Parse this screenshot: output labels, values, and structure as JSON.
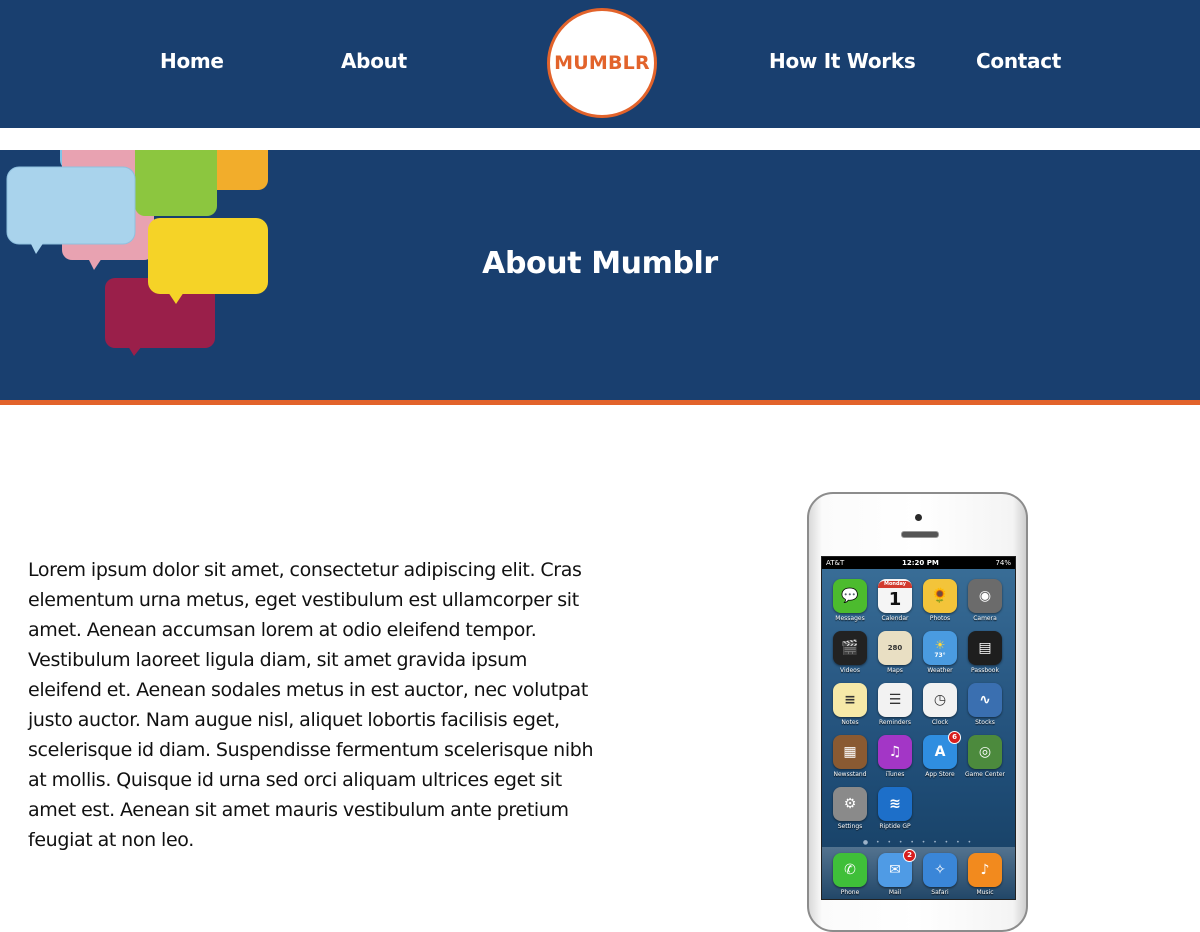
{
  "nav": {
    "links": [
      "Home",
      "About",
      "How It Works",
      "Contact"
    ],
    "logo_text": "MUMBLR"
  },
  "hero": {
    "title": "About Mumblr"
  },
  "about": {
    "text": "Lorem ipsum dolor sit amet, consectetur adipiscing elit. Cras elementum urna metus, eget vestibulum est ullamcorper sit amet. Aenean accumsan lorem at odio eleifend tempor. Vestibulum laoreet ligula diam, sit amet gravida ipsum eleifend et. Aenean sodales metus in est auctor, nec volutpat justo auctor. Nam augue nisl, aliquet lobortis facilisis eget, scelerisque id diam. Suspendisse fermentum scelerisque nibh at mollis. Quisque id urna sed orci aliquam ultrices eget sit amet est. Aenean sit amet mauris vestibulum ante pretium feugiat at non leo."
  },
  "phone": {
    "status": {
      "carrier": "AT&T",
      "time": "12:20 PM",
      "battery": "74%"
    },
    "calendar": {
      "weekday": "Monday",
      "day": "1"
    },
    "weather_temp": "73°",
    "apps": [
      {
        "label": "Messages",
        "color": "#4cbb2e",
        "icon": "messages-icon",
        "glyph": "💬"
      },
      {
        "label": "Calendar",
        "color": "#f5f5f5",
        "icon": "calendar-icon",
        "glyph": ""
      },
      {
        "label": "Photos",
        "color": "#f3c43a",
        "icon": "photos-icon",
        "glyph": "🌻"
      },
      {
        "label": "Camera",
        "color": "#6b6b6b",
        "icon": "camera-icon",
        "glyph": "◉"
      },
      {
        "label": "Videos",
        "color": "#222222",
        "icon": "videos-icon",
        "glyph": "🎬"
      },
      {
        "label": "Maps",
        "color": "#e9dfc3",
        "icon": "maps-icon",
        "glyph": "280"
      },
      {
        "label": "Weather",
        "color": "#4a9be0",
        "icon": "weather-icon",
        "glyph": "☀"
      },
      {
        "label": "Passbook",
        "color": "#1e1e1e",
        "icon": "passbook-icon",
        "glyph": "▤"
      },
      {
        "label": "Notes",
        "color": "#f6e9a8",
        "icon": "notes-icon",
        "glyph": "≡"
      },
      {
        "label": "Reminders",
        "color": "#f2f2f2",
        "icon": "reminders-icon",
        "glyph": "☰"
      },
      {
        "label": "Clock",
        "color": "#f2f2f2",
        "icon": "clock-icon",
        "glyph": "◷"
      },
      {
        "label": "Stocks",
        "color": "#3a6fb0",
        "icon": "stocks-icon",
        "glyph": "∿"
      },
      {
        "label": "Newsstand",
        "color": "#8a5a32",
        "icon": "newsstand-icon",
        "glyph": "▦"
      },
      {
        "label": "iTunes",
        "color": "#a336c6",
        "icon": "itunes-icon",
        "glyph": "♫"
      },
      {
        "label": "App Store",
        "color": "#2f8ee0",
        "icon": "app-store-icon",
        "glyph": "A",
        "badge": "6"
      },
      {
        "label": "Game Center",
        "color": "#4c8a3d",
        "icon": "game-center-icon",
        "glyph": "◎"
      },
      {
        "label": "Settings",
        "color": "#8a8a8a",
        "icon": "settings-icon",
        "glyph": "⚙"
      },
      {
        "label": "Riptide GP",
        "color": "#1d6fc9",
        "icon": "riptide-gp-icon",
        "glyph": "≋"
      }
    ],
    "dock": [
      {
        "label": "Phone",
        "color": "#3fbf39",
        "icon": "phone-icon",
        "glyph": "✆"
      },
      {
        "label": "Mail",
        "color": "#4f9be5",
        "icon": "mail-icon",
        "glyph": "✉",
        "badge": "2"
      },
      {
        "label": "Safari",
        "color": "#3a86d8",
        "icon": "safari-icon",
        "glyph": "✧"
      },
      {
        "label": "Music",
        "color": "#f28a1e",
        "icon": "music-icon",
        "glyph": "♪"
      }
    ]
  },
  "colors": {
    "navy": "#193f6f",
    "accent": "#e2632b"
  }
}
